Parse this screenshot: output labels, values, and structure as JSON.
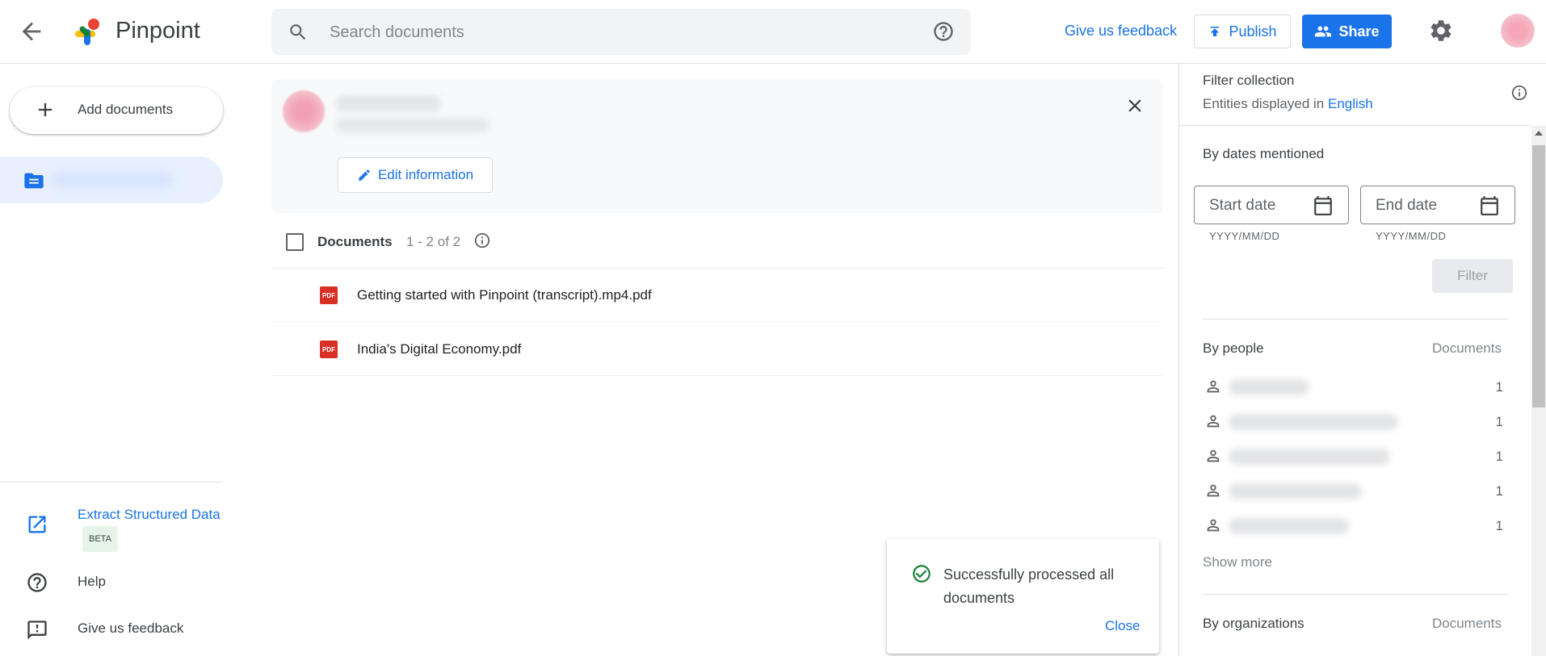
{
  "header": {
    "app_title": "Pinpoint",
    "search_placeholder": "Search documents",
    "feedback_label": "Give us feedback",
    "publish_label": "Publish",
    "share_label": "Share"
  },
  "colors": {
    "accent": "#1a73e8",
    "nav_selected": "#e8f0fe",
    "pdf": "#d93025",
    "success": "#188038"
  },
  "nav": {
    "add_documents_label": "Add documents",
    "extract_label": "Extract Structured Data",
    "beta_label": "BETA",
    "help_label": "Help",
    "feedback_label": "Give us feedback"
  },
  "collection": {
    "edit_label": "Edit information"
  },
  "documents": {
    "label": "Documents",
    "count_text": "1 - 2 of 2",
    "items": [
      {
        "icon": "pdf-icon",
        "icon_text": "PDF",
        "name": "Getting started with Pinpoint (transcript).mp4.pdf"
      },
      {
        "icon": "pdf-icon",
        "icon_text": "PDF",
        "name": "India's Digital Economy.pdf"
      }
    ]
  },
  "toast": {
    "message": "Successfully processed all documents",
    "close_label": "Close"
  },
  "filter_panel": {
    "title": "Filter collection",
    "entities_prefix": "Entities displayed in",
    "language": "English",
    "dates_section": "By dates mentioned",
    "start_date_placeholder": "Start date",
    "end_date_placeholder": "End date",
    "date_format_hint": "YYYY/MM/DD",
    "filter_label": "Filter",
    "people_section": "By people",
    "documents_col": "Documents",
    "people_counts": [
      "1",
      "1",
      "1",
      "1",
      "1"
    ],
    "show_more_label": "Show more",
    "orgs_section": "By organizations",
    "orgs_documents_col": "Documents"
  }
}
